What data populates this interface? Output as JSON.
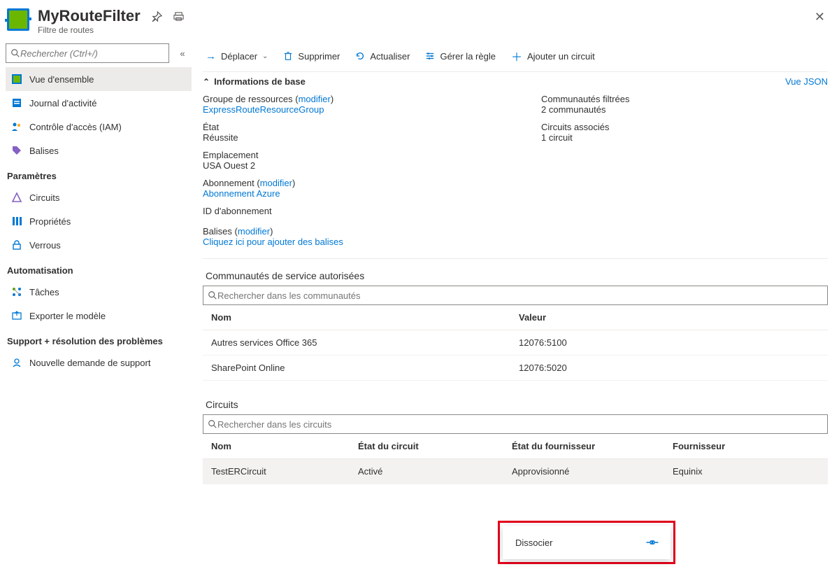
{
  "header": {
    "title": "MyRouteFilter",
    "subtitle": "Filtre de routes"
  },
  "sidebar": {
    "search_placeholder": "Rechercher (Ctrl+/)",
    "items": [
      {
        "label": "Vue d'ensemble"
      },
      {
        "label": "Journal d'activité"
      },
      {
        "label": "Contrôle d'accès (IAM)"
      },
      {
        "label": "Balises"
      }
    ],
    "section_params": "Paramètres",
    "params": [
      {
        "label": "Circuits"
      },
      {
        "label": "Propriétés"
      },
      {
        "label": "Verrous"
      }
    ],
    "section_auto": "Automatisation",
    "auto": [
      {
        "label": "Tâches"
      },
      {
        "label": "Exporter le modèle"
      }
    ],
    "section_support": "Support + résolution des problèmes",
    "support": [
      {
        "label": "Nouvelle demande de support"
      }
    ]
  },
  "toolbar": {
    "move": "Déplacer",
    "delete": "Supprimer",
    "refresh": "Actualiser",
    "manage_rule": "Gérer la règle",
    "add_circuit": "Ajouter un circuit"
  },
  "essentials": {
    "title": "Informations de base",
    "view_json": "Vue JSON",
    "modify": "modifier",
    "rg_label": "Groupe de ressources",
    "rg_value": "ExpressRouteResourceGroup",
    "state_label": "État",
    "state_value": "Réussite",
    "location_label": "Emplacement",
    "location_value": "USA Ouest 2",
    "sub_label": "Abonnement",
    "sub_value": "Abonnement Azure",
    "subid_label": "ID d'abonnement",
    "tags_label": "Balises",
    "tags_link": "Cliquez ici pour ajouter des balises",
    "communities_label": "Communautés filtrées",
    "communities_value": "2 communautés",
    "circuits_label": "Circuits associés",
    "circuits_value": "1 circuit"
  },
  "communities": {
    "title": "Communautés de service autorisées",
    "search_placeholder": "Rechercher dans les communautés",
    "col_name": "Nom",
    "col_value": "Valeur",
    "rows": [
      {
        "name": "Autres services Office 365",
        "value": "12076:5100"
      },
      {
        "name": "SharePoint Online",
        "value": "12076:5020"
      }
    ]
  },
  "circuits": {
    "title": "Circuits",
    "search_placeholder": "Rechercher dans les circuits",
    "col_name": "Nom",
    "col_circuit_state": "État du circuit",
    "col_provider_state": "État du fournisseur",
    "col_provider": "Fournisseur",
    "rows": [
      {
        "name": "TestERCircuit",
        "circ_state": "Activé",
        "prov_state": "Approvisionné",
        "provider": "Equinix"
      }
    ]
  },
  "context_menu": {
    "dissociate": "Dissocier"
  }
}
